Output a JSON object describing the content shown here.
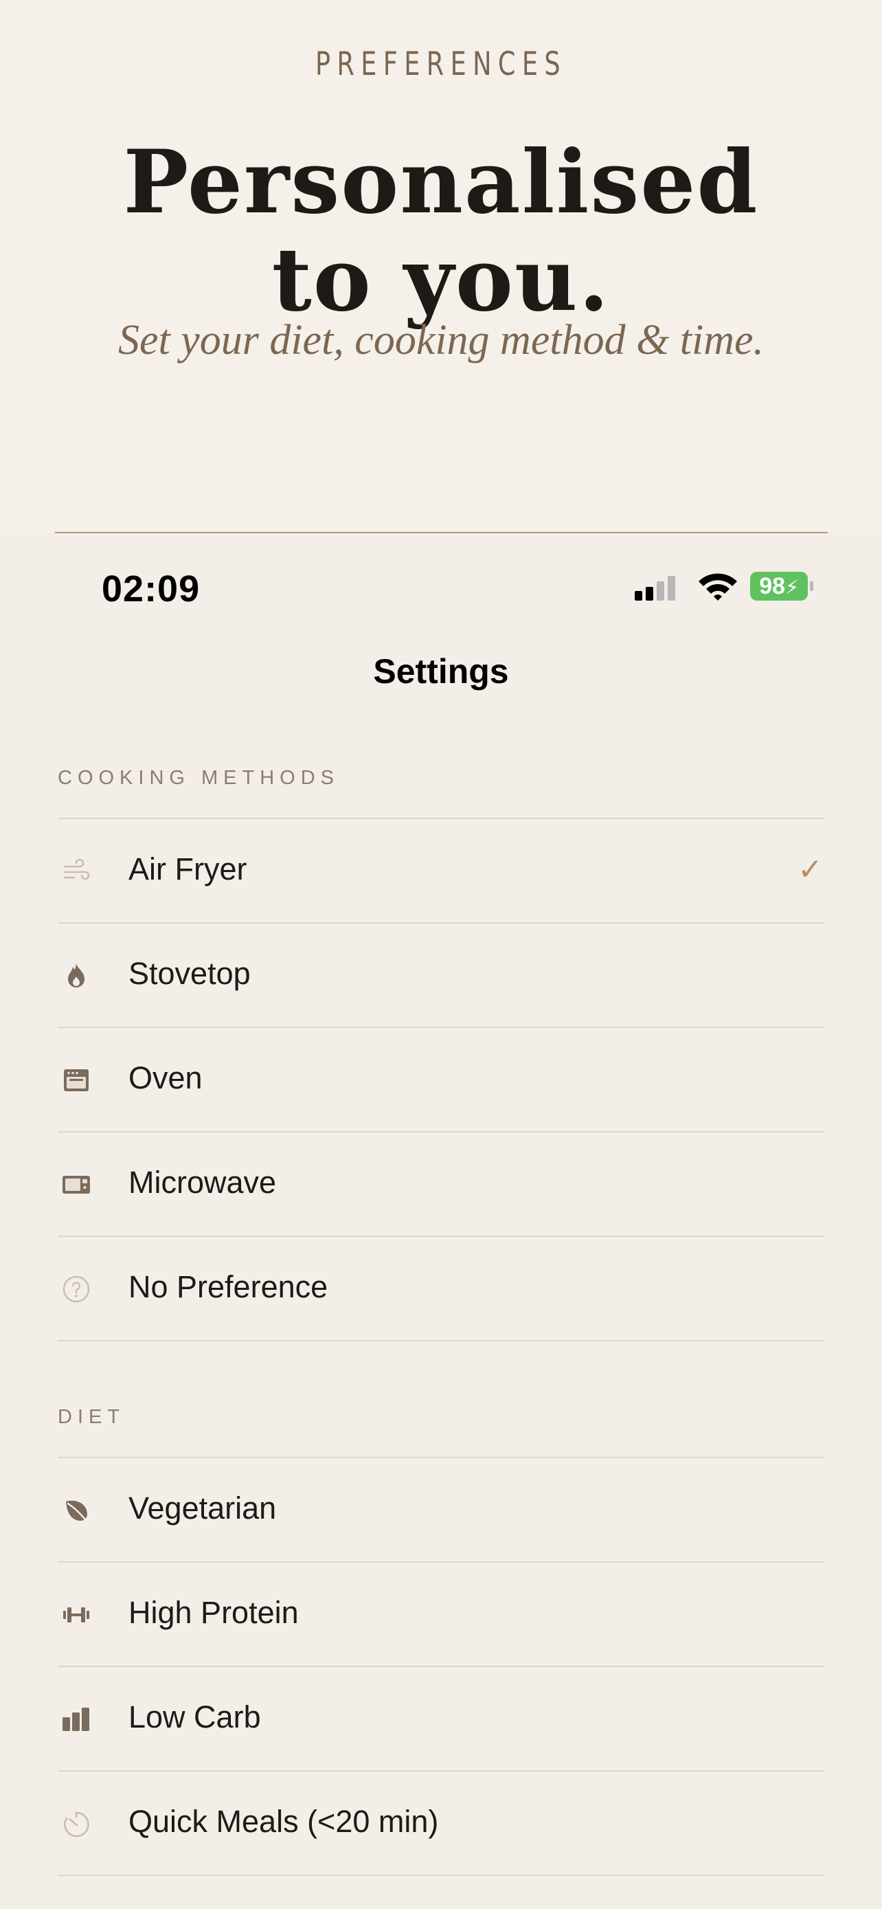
{
  "hero": {
    "eyebrow": "PREFERENCES",
    "headline_line1": "Personalised",
    "headline_line2": "to you.",
    "subline": "Set your diet, cooking method & time."
  },
  "status_bar": {
    "time": "02:09",
    "battery": "98",
    "battery_color": "#62c15f"
  },
  "nav": {
    "title": "Settings"
  },
  "sections": {
    "cooking": {
      "header": "COOKING METHODS",
      "items": [
        {
          "label": "Air Fryer",
          "icon": "air-fryer-icon",
          "selected": true
        },
        {
          "label": "Stovetop",
          "icon": "flame-icon",
          "selected": false
        },
        {
          "label": "Oven",
          "icon": "oven-icon",
          "selected": false
        },
        {
          "label": "Microwave",
          "icon": "microwave-icon",
          "selected": false
        },
        {
          "label": "No Preference",
          "icon": "question-icon",
          "selected": false
        }
      ]
    },
    "diet": {
      "header": "DIET",
      "items": [
        {
          "label": "Vegetarian",
          "icon": "leaf-icon",
          "selected": false
        },
        {
          "label": "High Protein",
          "icon": "dumbbell-icon",
          "selected": false
        },
        {
          "label": "Low Carb",
          "icon": "bars-icon",
          "selected": false
        },
        {
          "label": "Quick Meals (<20 min)",
          "icon": "timer-icon",
          "selected": false
        }
      ]
    }
  },
  "colors": {
    "accent": "#b48f69",
    "icon": "#7b6b5d",
    "background": "#f3efe8"
  }
}
